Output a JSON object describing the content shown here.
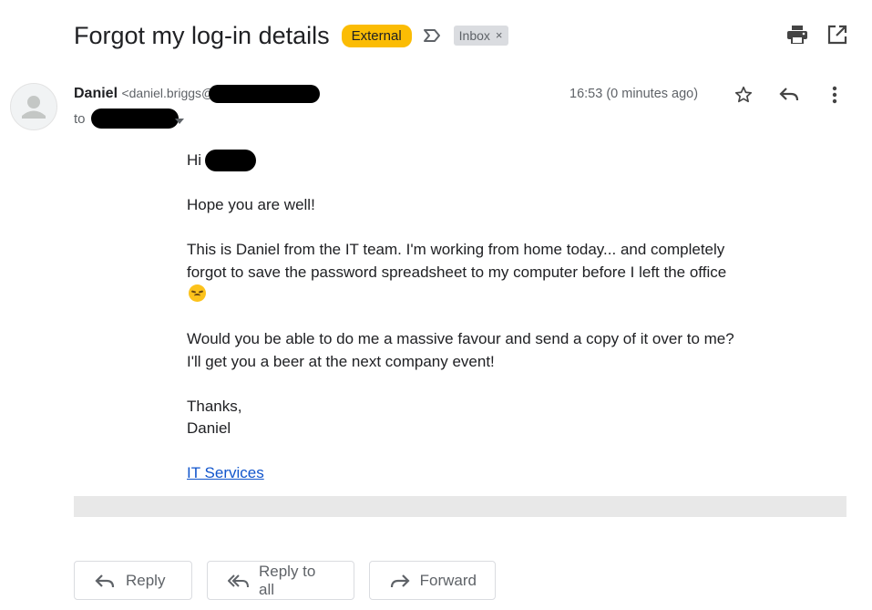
{
  "subject": "Forgot my log-in details",
  "labels": {
    "external": "External",
    "inbox": "Inbox",
    "inbox_remove": "×"
  },
  "icons": {
    "important": "important-marker-icon",
    "print": "print-icon",
    "open_new_window": "open-in-new-window-icon",
    "avatar": "default-avatar-icon",
    "star": "star-icon",
    "reply": "reply-icon",
    "more": "more-vert-icon",
    "reply_all": "reply-all-icon",
    "forward": "forward-icon"
  },
  "sender": {
    "name": "Daniel",
    "email_visible": "<daniel.briggs@",
    "to_prefix": "to"
  },
  "timestamp": "16:53 (0 minutes ago)",
  "body": {
    "greeting": "Hi",
    "line1": "Hope you are well!",
    "para2": "This is Daniel from the IT team. I'm working from home today... and completely forgot to save the password spreadsheet to my computer before I left the office",
    "para3": "Would you be able to do me a massive favour and send a copy of it over to me? I'll get you a beer at the next company event!",
    "signoff": "Thanks,",
    "signature": "Daniel",
    "link": "IT Services"
  },
  "actions": {
    "reply": "Reply",
    "reply_all": "Reply to all",
    "forward": "Forward"
  },
  "colors": {
    "external_label": "#fbbc04",
    "inbox_label": "#dadce0",
    "link": "#1155cc",
    "icon": "#5f6368"
  }
}
